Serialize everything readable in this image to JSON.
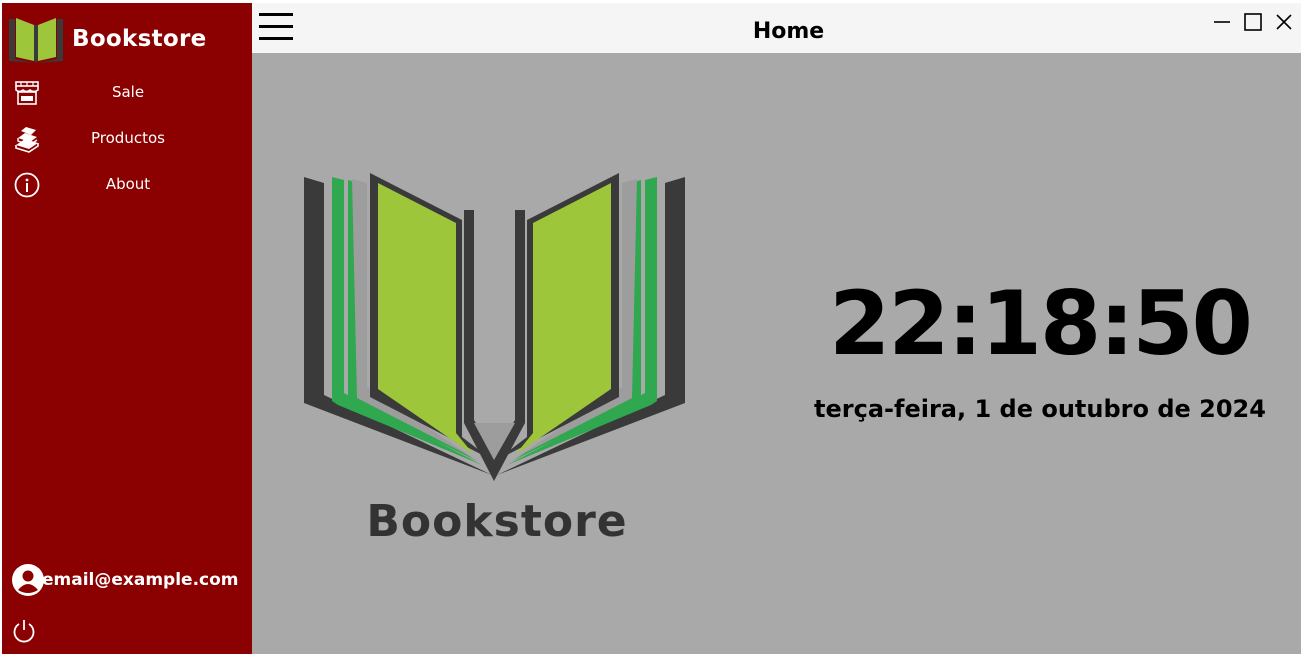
{
  "sidebar": {
    "brand": "Bookstore",
    "items": [
      {
        "label": "Sale",
        "icon": "store-icon"
      },
      {
        "label": "Productos",
        "icon": "books-icon"
      },
      {
        "label": "About",
        "icon": "info-icon"
      }
    ],
    "user_email": "email@example.com",
    "power_icon": "power-icon"
  },
  "header": {
    "title": "Home"
  },
  "main": {
    "logo_text": "Bookstore",
    "time": "22:18:50",
    "date": "terça-feira, 1 de outubro de 2024"
  },
  "colors": {
    "sidebar_bg": "#8b0000",
    "content_bg": "#a9a9a9",
    "header_bg": "#f5f5f5",
    "book_green": "#9dc63b",
    "book_dark": "#3a3a3a"
  }
}
